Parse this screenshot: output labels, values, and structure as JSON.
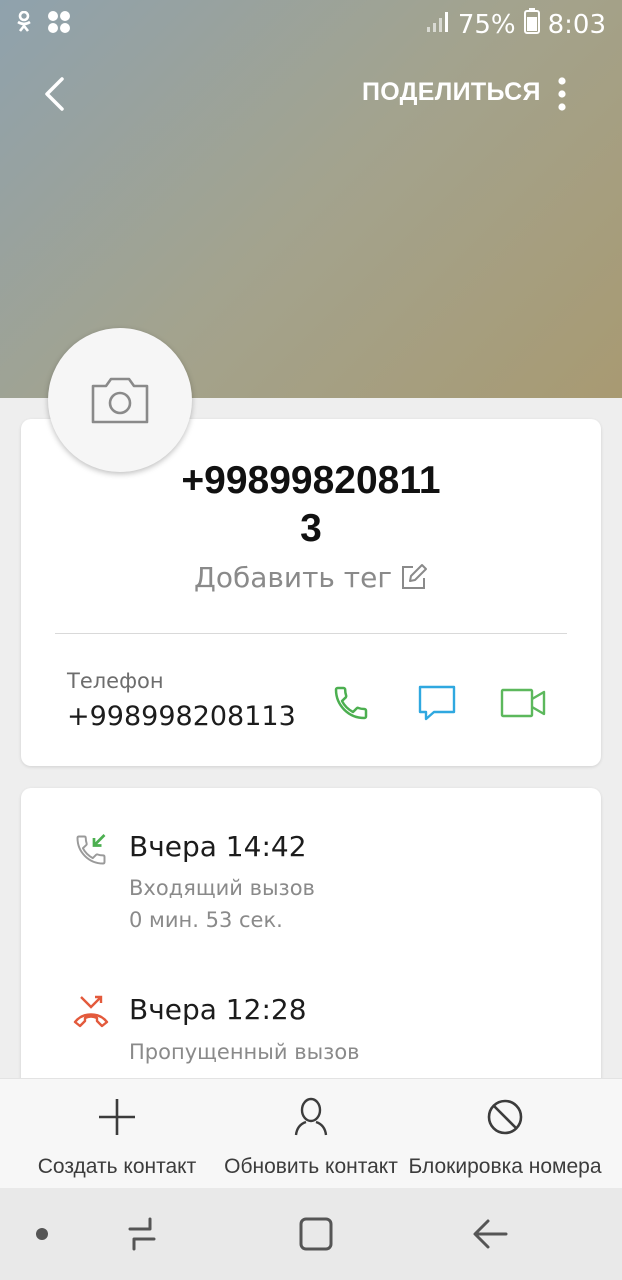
{
  "status_bar": {
    "battery": "75%",
    "time": "8:03"
  },
  "toolbar": {
    "share_label": "ПОДЕЛИТЬСЯ"
  },
  "contact": {
    "title": "+99899820811\n3",
    "tag_label": "Добавить тег",
    "phone_label": "Телефон",
    "phone_number": "+998998208113"
  },
  "call_log": [
    {
      "type": "incoming",
      "title": "Вчера 14:42",
      "subtitle": "Входящий вызов",
      "duration": "0 мин. 53 сек."
    },
    {
      "type": "missed",
      "title": "Вчера 12:28",
      "subtitle": "Пропущенный вызов"
    }
  ],
  "bottom_actions": [
    {
      "label": "Создать контакт",
      "icon": "plus-icon"
    },
    {
      "label": "Обновить контакт",
      "icon": "person-icon"
    },
    {
      "label": "Блокировка номера",
      "icon": "block-icon"
    }
  ],
  "colors": {
    "call": "#4caf50",
    "message": "#2fa8e0",
    "video": "#5cb85c",
    "missed": "#e35a3c"
  }
}
